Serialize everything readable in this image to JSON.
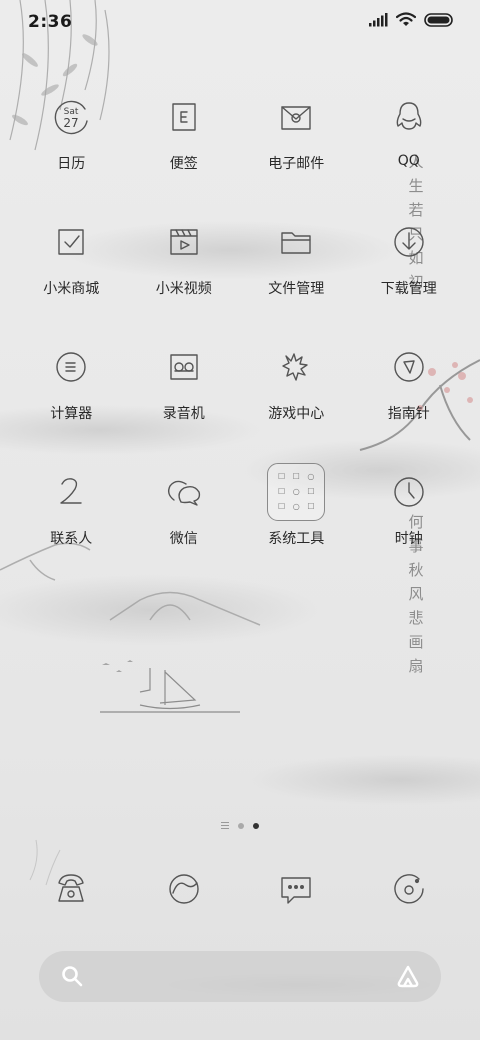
{
  "status_bar": {
    "time": "2:36"
  },
  "calendar_icon": {
    "weekday": "Sat",
    "day": "27"
  },
  "apps": [
    {
      "label": "日历",
      "icon": "calendar-icon"
    },
    {
      "label": "便签",
      "icon": "notes-icon"
    },
    {
      "label": "电子邮件",
      "icon": "email-icon"
    },
    {
      "label": "QQ",
      "icon": "qq-icon"
    },
    {
      "label": "小米商城",
      "icon": "mi-store-icon"
    },
    {
      "label": "小米视频",
      "icon": "mi-video-icon"
    },
    {
      "label": "文件管理",
      "icon": "folder-icon"
    },
    {
      "label": "下载管理",
      "icon": "download-icon"
    },
    {
      "label": "计算器",
      "icon": "calculator-icon"
    },
    {
      "label": "录音机",
      "icon": "recorder-icon"
    },
    {
      "label": "游戏中心",
      "icon": "game-center-icon"
    },
    {
      "label": "指南针",
      "icon": "compass-icon"
    },
    {
      "label": "联系人",
      "icon": "contacts-icon"
    },
    {
      "label": "微信",
      "icon": "wechat-icon"
    },
    {
      "label": "系统工具",
      "icon": "system-tools-folder-icon"
    },
    {
      "label": "时钟",
      "icon": "clock-icon"
    }
  ],
  "poem_line_1": "人生若只如初",
  "poem_line_2": "何事秋风悲画扇",
  "dock": [
    {
      "icon": "phone-icon"
    },
    {
      "icon": "browser-icon"
    },
    {
      "icon": "messages-icon"
    },
    {
      "icon": "camera-icon"
    }
  ],
  "page_indicator": {
    "pages": 3,
    "active": 3
  }
}
